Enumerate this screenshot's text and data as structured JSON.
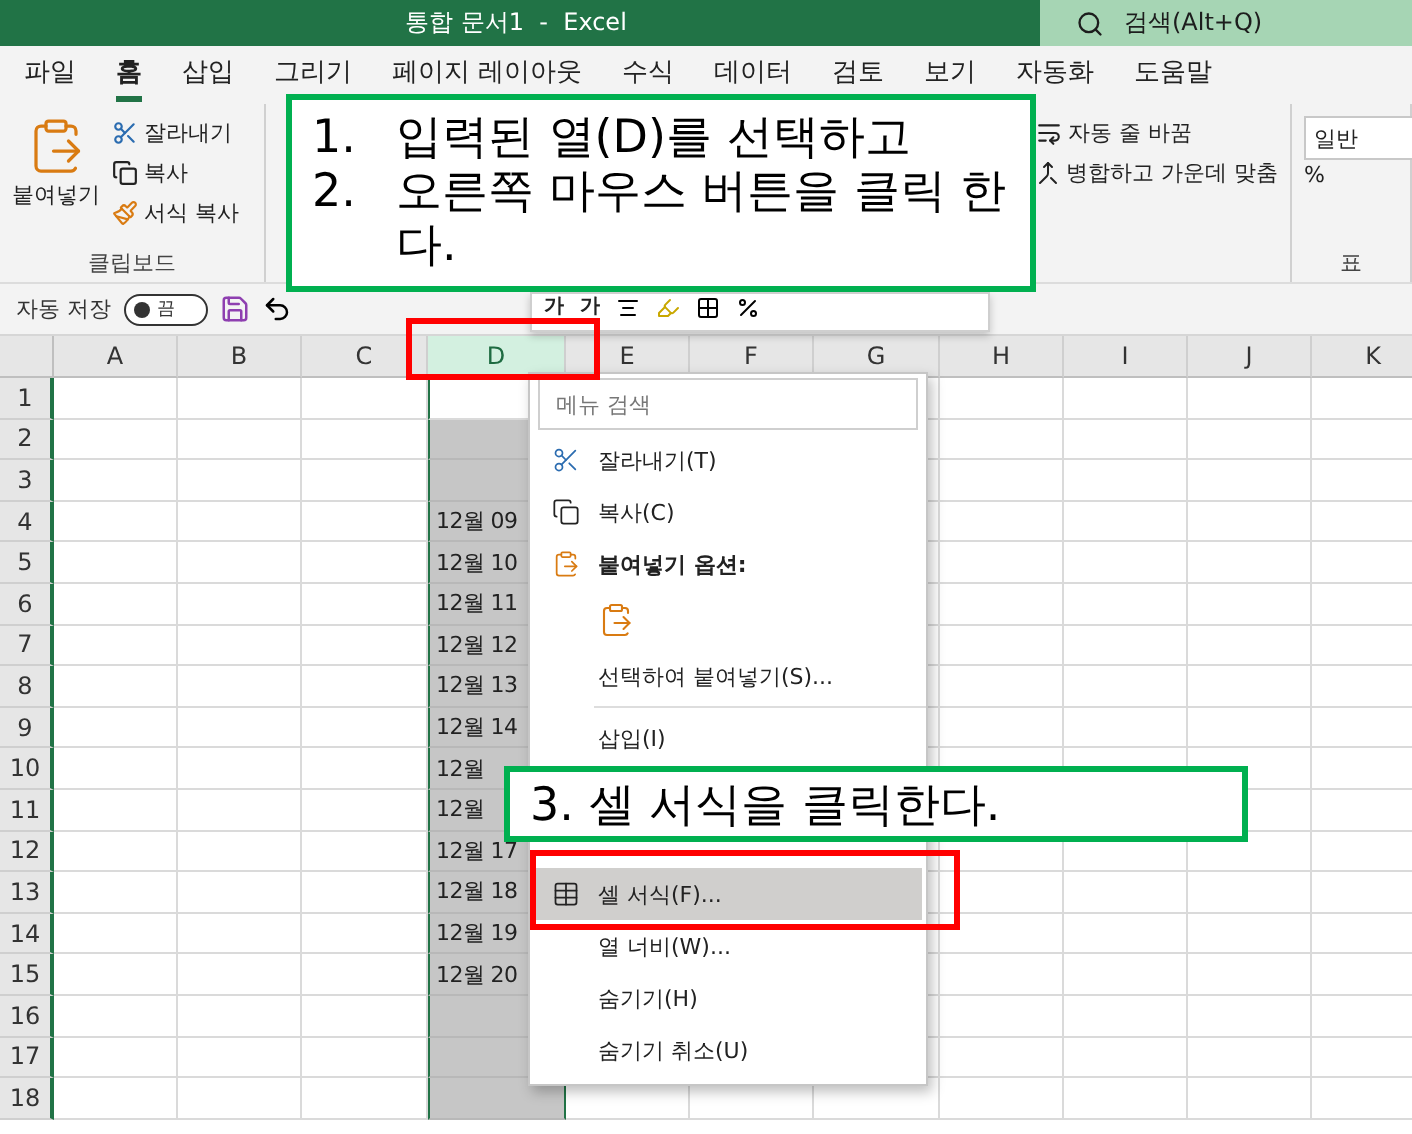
{
  "window": {
    "title": "통합 문서1  -  Excel",
    "search": {
      "placeholder": "검색(Alt+Q)"
    }
  },
  "ribbon_tabs": [
    {
      "label": "파일",
      "selected": false
    },
    {
      "label": "홈",
      "selected": true
    },
    {
      "label": "삽입",
      "selected": false
    },
    {
      "label": "그리기",
      "selected": false
    },
    {
      "label": "페이지 레이아웃",
      "selected": false
    },
    {
      "label": "수식",
      "selected": false
    },
    {
      "label": "데이터",
      "selected": false
    },
    {
      "label": "검토",
      "selected": false
    },
    {
      "label": "보기",
      "selected": false
    },
    {
      "label": "자동화",
      "selected": false
    },
    {
      "label": "도움말",
      "selected": false
    }
  ],
  "ribbon": {
    "clipboard": {
      "paste": "붙여넣기",
      "cut": "잘라내기",
      "copy": "복사",
      "format_painter": "서식 복사",
      "group_label": "클립보드"
    },
    "alignment": {
      "wrap_text": "자동 줄 바꿈",
      "merge_center": "병합하고 가운데 맞춤"
    },
    "number": {
      "format": "일반",
      "percent": "%",
      "group_label": "표"
    }
  },
  "quick_access": {
    "autosave_label": "자동 저장",
    "autosave": {
      "on": false,
      "state_text": "끔"
    }
  },
  "mini_toolbar": {
    "buttons": [
      "가",
      "가"
    ]
  },
  "sheet": {
    "columns": [
      {
        "label": "A",
        "selected": false
      },
      {
        "label": "B",
        "selected": false
      },
      {
        "label": "C",
        "selected": false
      },
      {
        "label": "D",
        "selected": true
      },
      {
        "label": "E",
        "selected": false
      },
      {
        "label": "F",
        "selected": false
      },
      {
        "label": "G",
        "selected": false
      },
      {
        "label": "H",
        "selected": false
      },
      {
        "label": "I",
        "selected": false
      },
      {
        "label": "J",
        "selected": false
      },
      {
        "label": "K",
        "selected": false
      }
    ],
    "rows": [
      {
        "label": "1"
      },
      {
        "label": "2"
      },
      {
        "label": "3"
      },
      {
        "label": "4",
        "column_d": "12월 09"
      },
      {
        "label": "5",
        "column_d": "12월 10"
      },
      {
        "label": "6",
        "column_d": "12월 11"
      },
      {
        "label": "7",
        "column_d": "12월 12"
      },
      {
        "label": "8",
        "column_d": "12월 13"
      },
      {
        "label": "9",
        "column_d": "12월 14"
      },
      {
        "label": "10",
        "column_d": "12월"
      },
      {
        "label": "11",
        "column_d": "12월"
      },
      {
        "label": "12",
        "column_d": "12월 17"
      },
      {
        "label": "13",
        "column_d": "12월 18"
      },
      {
        "label": "14",
        "column_d": "12월 19"
      },
      {
        "label": "15",
        "column_d": "12월 20"
      },
      {
        "label": "16"
      },
      {
        "label": "17"
      },
      {
        "label": "18"
      }
    ]
  },
  "context_menu": {
    "search": {
      "placeholder": "메뉴 검색"
    },
    "items": [
      {
        "kind": "cut",
        "label": "잘라내기(T)",
        "selected": false
      },
      {
        "kind": "copy",
        "label": "복사(C)",
        "selected": false
      },
      {
        "kind": "header",
        "label": "붙여넣기 옵션:",
        "selected": false
      },
      {
        "kind": "paste",
        "selected": false
      },
      {
        "kind": "item",
        "label": "선택하여 붙여넣기(S)...",
        "selected": false
      },
      {
        "kind": "separator"
      },
      {
        "kind": "item",
        "label": "삽입(I)",
        "selected": false
      },
      {
        "kind": "format",
        "label": "셀 서식(F)...",
        "selected": true
      },
      {
        "kind": "item",
        "label": "열 너비(W)...",
        "selected": false
      },
      {
        "kind": "item",
        "label": "숨기기(H)",
        "selected": false
      },
      {
        "kind": "item",
        "label": "숨기기 취소(U)",
        "selected": false
      }
    ]
  },
  "annotations": [
    {
      "kind": "steps",
      "lines": [
        {
          "number": "1.",
          "text": "입력된 열(D)를 선택하고"
        },
        {
          "number": "2.",
          "text": "오른쪽 마우스 버튼을 클릭 한다."
        }
      ]
    },
    {
      "kind": "single",
      "text": "3. 셀 서식을 클릭한다."
    }
  ]
}
